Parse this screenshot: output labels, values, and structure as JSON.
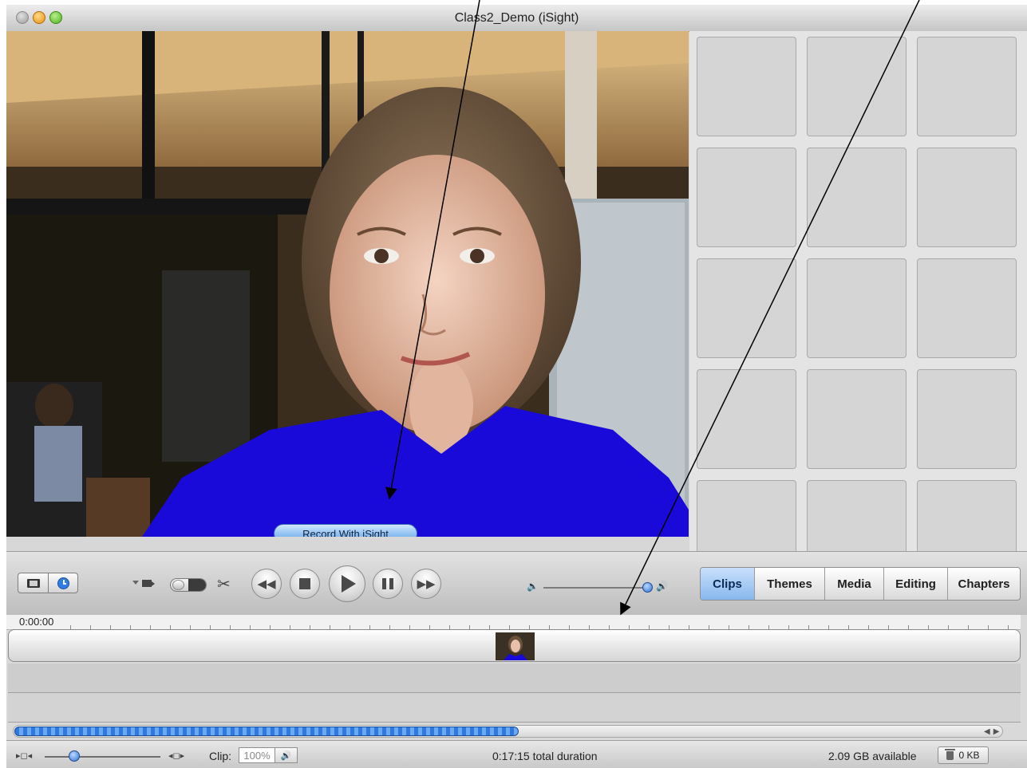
{
  "window": {
    "title": "Class2_Demo (iSight)"
  },
  "video": {
    "record_button": "Record With iSight"
  },
  "tabs": [
    {
      "label": "Clips",
      "active": true
    },
    {
      "label": "Themes",
      "active": false
    },
    {
      "label": "Media",
      "active": false
    },
    {
      "label": "Editing",
      "active": false
    },
    {
      "label": "Chapters",
      "active": false
    }
  ],
  "timeline": {
    "start_time": "0:00:00"
  },
  "clip_panel": {
    "slot_count": 15
  },
  "status": {
    "clip_label": "Clip:",
    "clip_volume": "100%",
    "duration": "0:17:15 total duration",
    "available": "2.09 GB available",
    "trash": "0 KB"
  },
  "icons": [
    "film-icon",
    "clock-icon",
    "camera-icon",
    "scissors-icon",
    "rewind-icon",
    "stop-icon",
    "play-icon",
    "pause-icon",
    "fast-forward-icon",
    "volume-low-icon",
    "volume-high-icon",
    "trash-icon"
  ],
  "colors": {
    "accent": "#2f7ee8",
    "tab_active": "#88b8ee",
    "shirt": "#1a0ad9"
  }
}
